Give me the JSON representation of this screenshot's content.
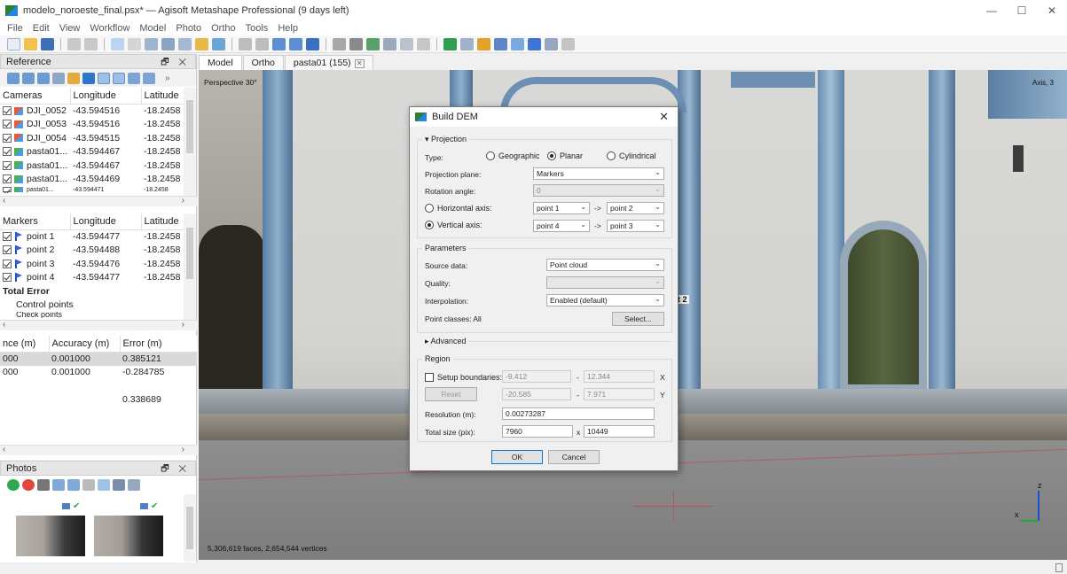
{
  "window": {
    "title": "modelo_noroeste_final.psx* — Agisoft Metashape Professional (9 days left)",
    "minimize": "—",
    "maximize": "☐",
    "close": "✕"
  },
  "menu": [
    "File",
    "Edit",
    "View",
    "Workflow",
    "Model",
    "Photo",
    "Ortho",
    "Tools",
    "Help"
  ],
  "reference": {
    "title": "Reference",
    "controls": "🗗 ✕",
    "cameras_header": [
      "Cameras",
      "Longitude",
      "Latitude"
    ],
    "cameras": [
      {
        "name": "DJI_0052",
        "lon": "-43.594516",
        "lat": "-18.2458"
      },
      {
        "name": "DJI_0053",
        "lon": "-43.594516",
        "lat": "-18.2458"
      },
      {
        "name": "DJI_0054",
        "lon": "-43.594515",
        "lat": "-18.2458"
      },
      {
        "name": "pasta01...",
        "lon": "-43.594467",
        "lat": "-18.2458"
      },
      {
        "name": "pasta01...",
        "lon": "-43.594467",
        "lat": "-18.2458"
      },
      {
        "name": "pasta01...",
        "lon": "-43.594469",
        "lat": "-18.2458"
      },
      {
        "name": "pasta01...",
        "lon": "-43.594471",
        "lat": "-18.2458"
      }
    ],
    "markers_header": [
      "Markers",
      "Longitude",
      "Latitude"
    ],
    "markers": [
      {
        "name": "point 1",
        "lon": "-43.594477",
        "lat": "-18.2458"
      },
      {
        "name": "point 2",
        "lon": "-43.594488",
        "lat": "-18.2458"
      },
      {
        "name": "point 3",
        "lon": "-43.594476",
        "lat": "-18.2458"
      },
      {
        "name": "point 4",
        "lon": "-43.594477",
        "lat": "-18.2458"
      }
    ],
    "total_error": "Total Error",
    "control_points": "Control points",
    "check_points": "Check points",
    "error_header": [
      "nce (m)",
      "Accuracy (m)",
      "Error (m)"
    ],
    "error_rows": [
      {
        "a": "000",
        "b": "0.001000",
        "c": "0.385121"
      },
      {
        "a": "000",
        "b": "0.001000",
        "c": "-0.284785"
      },
      {
        "a": "",
        "b": "",
        "c": ""
      },
      {
        "a": "",
        "b": "",
        "c": "0.338689"
      }
    ]
  },
  "photos": {
    "title": "Photos",
    "controls": "🗗 ✕"
  },
  "tabs": [
    "Model",
    "Ortho",
    "pasta01 (155)"
  ],
  "viewport": {
    "perspective": "Perspective 30°",
    "stats": "5,306,619 faces, 2,654,544 vertices",
    "marker_label": "t 2",
    "axis_z": "z",
    "axis_x": "x",
    "corner": "Axis, 3"
  },
  "dialog": {
    "title": "Build DEM",
    "close": "✕",
    "projection": {
      "section": "Projection",
      "type_label": "Type:",
      "types": [
        "Geographic",
        "Planar",
        "Cylindrical"
      ],
      "plane_label": "Projection plane:",
      "plane_value": "Markers",
      "rotation_label": "Rotation angle:",
      "rotation_value": "0",
      "horizontal_label": "Horizontal axis:",
      "horizontal_from": "point 1",
      "horizontal_to": "point 2",
      "vertical_label": "Vertical axis:",
      "vertical_from": "point 4",
      "vertical_to": "point 3",
      "arrow": "->"
    },
    "parameters": {
      "section": "Parameters",
      "source_label": "Source data:",
      "source_value": "Point cloud",
      "quality_label": "Quality:",
      "quality_value": "",
      "interp_label": "Interpolation:",
      "interp_value": "Enabled (default)",
      "classes_label": "Point classes: All",
      "select_button": "Select..."
    },
    "advanced": "Advanced",
    "region": {
      "section": "Region",
      "setup_label": "Setup boundaries:",
      "x_min": "-9.412",
      "x_max": "12.344",
      "y_min": "-20.585",
      "y_max": "7.971",
      "x_axis": "X",
      "y_axis": "Y",
      "dash": "-",
      "reset_button": "Reset",
      "resolution_label": "Resolution (m):",
      "resolution_value": "0.00273287",
      "size_label": "Total size (pix):",
      "size_w": "7960",
      "size_x": "x",
      "size_h": "10449"
    },
    "ok": "OK",
    "cancel": "Cancel"
  },
  "colors": {
    "accent": "#0078d7",
    "marker_blue": "#2b63e0",
    "wall": "#d6d6d3"
  }
}
